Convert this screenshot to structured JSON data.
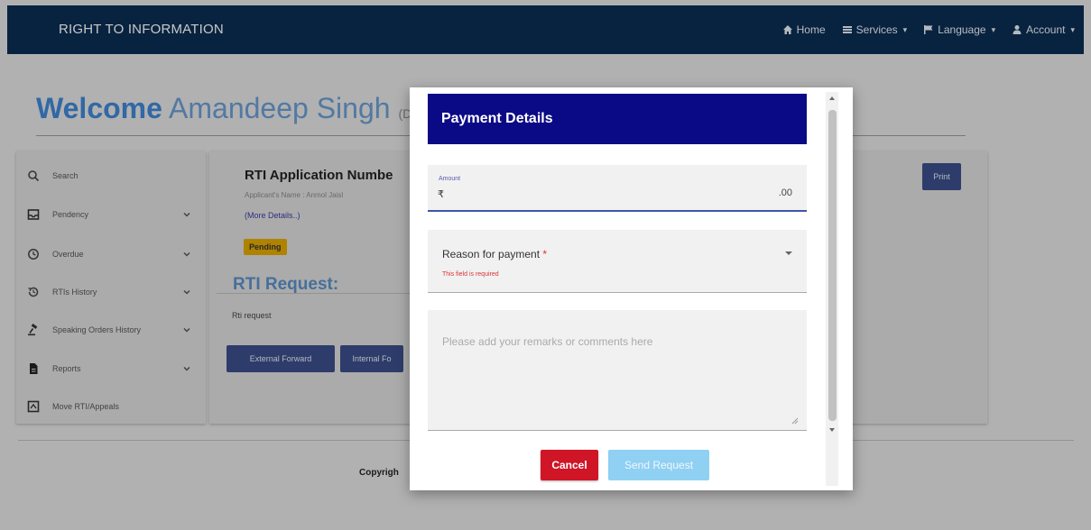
{
  "navbar": {
    "brand": "RIGHT TO INFORMATION",
    "items": [
      {
        "label": "Home",
        "icon": "home-icon"
      },
      {
        "label": "Services",
        "icon": "list-icon"
      },
      {
        "label": "Language",
        "icon": "flag-icon"
      },
      {
        "label": "Account",
        "icon": "user-icon"
      }
    ],
    "background": "#0b2e52"
  },
  "welcome": {
    "greeting": "Welcome",
    "name": "Amandeep Singh",
    "dept_partial": "(DE"
  },
  "sidebar": {
    "items": [
      {
        "label": "Search",
        "icon": "search-icon",
        "expandable": false
      },
      {
        "label": "Pendency",
        "icon": "inbox-icon",
        "expandable": true
      },
      {
        "label": "Overdue",
        "icon": "clock-icon",
        "expandable": true
      },
      {
        "label": "RTIs History",
        "icon": "history-icon",
        "expandable": true
      },
      {
        "label": "Speaking Orders History",
        "icon": "gavel-icon",
        "expandable": true
      },
      {
        "label": "Reports",
        "icon": "file-icon",
        "expandable": true
      },
      {
        "label": "Move RTI/Appeals",
        "icon": "move-icon",
        "expandable": false
      }
    ]
  },
  "main": {
    "rti_title_partial": "RTI Application Numbe",
    "applicant_partial": "Applicant's Name : Anmol Jaisl",
    "more_details": "(More Details..)",
    "status": "Pending",
    "request_heading": "RTI Request:",
    "request_text": "Rti request",
    "buttons": {
      "external_forward": "External Forward",
      "internal_forward_partial": "Internal Fo",
      "print": "Print"
    },
    "copyright_partial": "Copyrigh"
  },
  "modal": {
    "title": "Payment Details",
    "amount": {
      "label": "Amount",
      "currency_symbol": "₹",
      "decimals": ".00"
    },
    "reason": {
      "label": "Reason for payment",
      "required_marker": "*",
      "error": "This field is required"
    },
    "remarks": {
      "placeholder": "Please add your remarks or comments here"
    },
    "cancel_label": "Cancel",
    "send_label": "Send Request",
    "colors": {
      "header": "#0a0a86",
      "cancel": "#d01526",
      "send_disabled": "#8fd0f3",
      "field_underline": "#3e56a8",
      "error": "#d33333"
    }
  }
}
